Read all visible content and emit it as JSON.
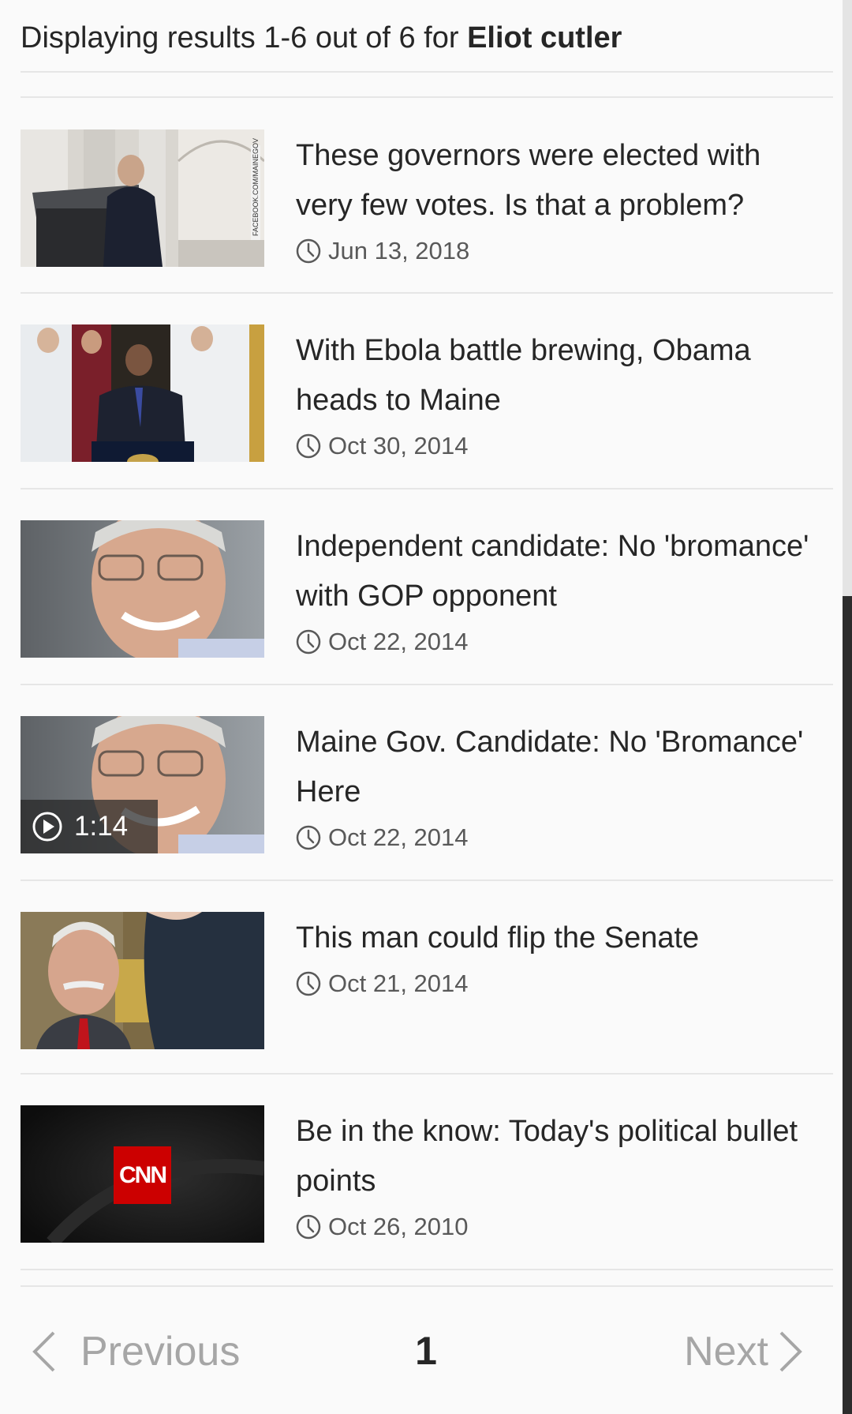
{
  "header": {
    "prefix": "Displaying results 1-6 out of 6 for ",
    "query": "Eliot cutler"
  },
  "results": [
    {
      "headline": "These governors were elected with very few votes. Is that a problem?",
      "date": "Jun 13, 2018",
      "thumbnail": "governor-at-podium",
      "thumbnail_caption": "FACEBOOK.COM/MAINEGOV"
    },
    {
      "headline": "With Ebola battle brewing, Obama heads to Maine",
      "date": "Oct 30, 2014",
      "thumbnail": "obama-at-podium"
    },
    {
      "headline": "Independent candidate: No 'bromance' with GOP opponent",
      "date": "Oct 22, 2014",
      "thumbnail": "smiling-candidate"
    },
    {
      "headline": "Maine Gov. Candidate: No 'Bromance' Here",
      "date": "Oct 22, 2014",
      "thumbnail": "smiling-candidate",
      "video_duration": "1:14"
    },
    {
      "headline": "This man could flip the Senate",
      "date": "Oct 21, 2014",
      "thumbnail": "senate-candidate-handshake"
    },
    {
      "headline": "Be in the know: Today's political bullet points",
      "date": "Oct 26, 2010",
      "thumbnail": "cnn-logo",
      "thumbnail_caption": "CNN"
    }
  ],
  "pagination": {
    "previous_label": "Previous",
    "current_page": "1",
    "next_label": "Next"
  },
  "colors": {
    "text": "#262626",
    "muted": "#595959",
    "disabled": "#a6a6a6",
    "divider": "#e6e6e6",
    "cnn_red": "#cc0000"
  }
}
